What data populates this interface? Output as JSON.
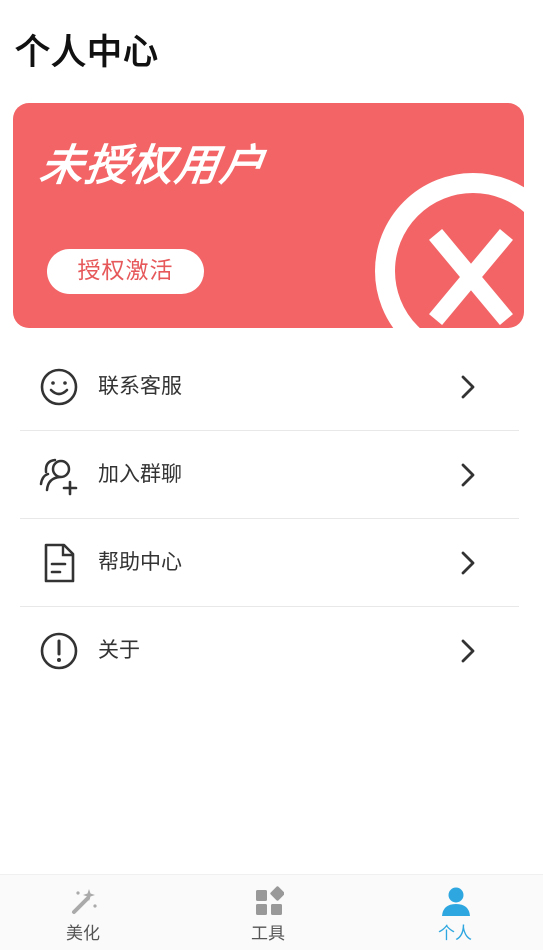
{
  "header": {
    "title": "个人中心"
  },
  "auth_card": {
    "status": "未授权用户",
    "activate_label": "授权激活",
    "badge_icon": "x-circle-icon",
    "background": "#f26466"
  },
  "menu": {
    "items": [
      {
        "label": "联系客服",
        "icon": "smile-icon"
      },
      {
        "label": "加入群聊",
        "icon": "add-user-icon"
      },
      {
        "label": "帮助中心",
        "icon": "document-icon"
      },
      {
        "label": "关于",
        "icon": "info-icon"
      }
    ]
  },
  "tabbar": {
    "tabs": [
      {
        "label": "美化",
        "icon": "magic-wand-icon"
      },
      {
        "label": "工具",
        "icon": "grid-icon"
      },
      {
        "label": "个人",
        "icon": "person-icon",
        "active": true
      }
    ],
    "active_color": "#2ea7e0"
  }
}
